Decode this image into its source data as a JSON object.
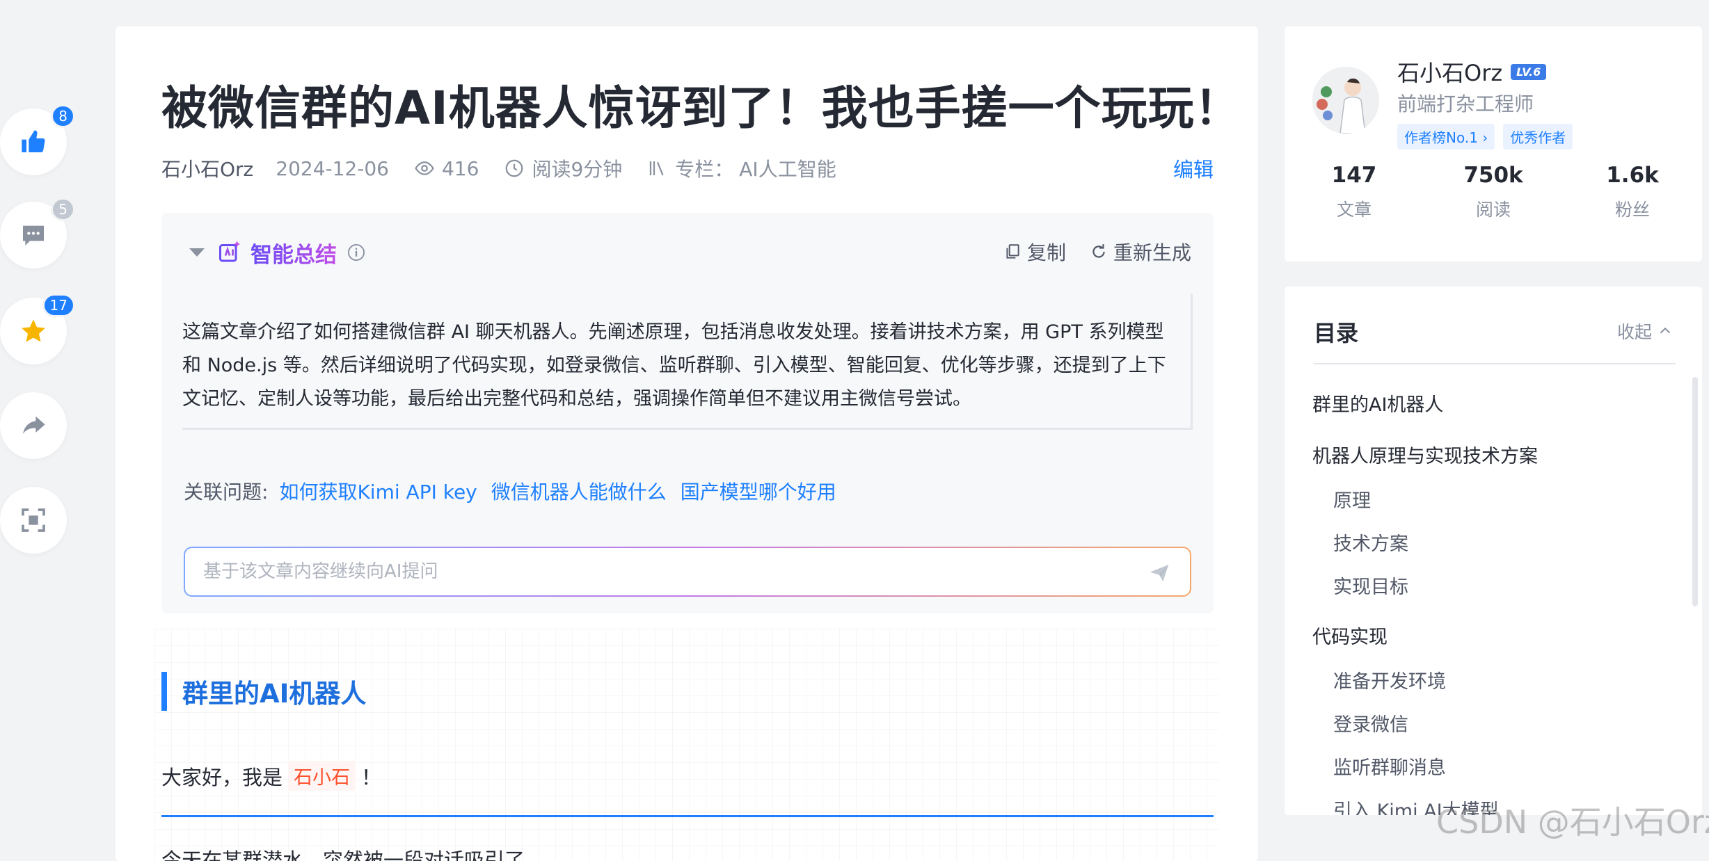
{
  "left_bar": {
    "like_count": "8",
    "comment_count": "5",
    "collect_count": "17",
    "icons": [
      "thumbs-up-icon",
      "comment-icon",
      "star-icon",
      "share-icon",
      "fullscreen-icon"
    ],
    "colors": {
      "like": "#1e80ff",
      "star": "#f7b500",
      "badge_blue": "#1e80ff",
      "badge_gray": "#c2c8d1"
    }
  },
  "article": {
    "title": "被微信群的AI机器人惊讶到了！我也手搓一个玩玩！",
    "author": "石小石Orz",
    "date": "2024-12-06",
    "views": "416",
    "read_time": "阅读9分钟",
    "column_label": "专栏：",
    "column_name": "AI人工智能",
    "edit_label": "编辑"
  },
  "summary": {
    "title": "智能总结",
    "copy_label": "复制",
    "regenerate_label": "重新生成",
    "text": "这篇文章介绍了如何搭建微信群 AI 聊天机器人。先阐述原理，包括消息收发处理。接着讲技术方案，用 GPT 系列模型和 Node.js 等。然后详细说明了代码实现，如登录微信、监听群聊、引入模型、智能回复、优化等步骤，还提到了上下文记忆、定制人设等功能，最后给出完整代码和总结，强调操作简单但不建议用主微信号尝试。",
    "related_label": "关联问题:",
    "related_questions": [
      "如何获取Kimi API key",
      "微信机器人能做什么",
      "国产模型哪个好用"
    ],
    "ask_placeholder": "基于该文章内容继续向AI提问"
  },
  "content": {
    "heading": "群里的AI机器人",
    "greeting_before": "大家好，我是",
    "greeting_code": "石小石",
    "greeting_after": "！",
    "para2": "今天在某群潜水，突然被一段对话吸引了。"
  },
  "author_card": {
    "name": "石小石Orz",
    "level": "LV.6",
    "title": "前端打杂工程师",
    "tags": [
      "作者榜No.1 ›",
      "优秀作者"
    ],
    "stats": [
      {
        "num": "147",
        "label": "文章"
      },
      {
        "num": "750k",
        "label": "阅读"
      },
      {
        "num": "1.6k",
        "label": "粉丝"
      }
    ]
  },
  "toc": {
    "title": "目录",
    "collapse_label": "收起",
    "items": [
      {
        "label": "群里的AI机器人",
        "level": 1
      },
      {
        "label": "机器人原理与实现技术方案",
        "level": 1
      },
      {
        "label": "原理",
        "level": 2
      },
      {
        "label": "技术方案",
        "level": 2
      },
      {
        "label": "实现目标",
        "level": 2
      },
      {
        "label": "代码实现",
        "level": 1
      },
      {
        "label": "准备开发环境",
        "level": 2
      },
      {
        "label": "登录微信",
        "level": 2
      },
      {
        "label": "监听群聊消息",
        "level": 2
      },
      {
        "label": "引入 Kimi AI大模型",
        "level": 2
      }
    ]
  },
  "watermark": "CSDN @石小石Orz"
}
